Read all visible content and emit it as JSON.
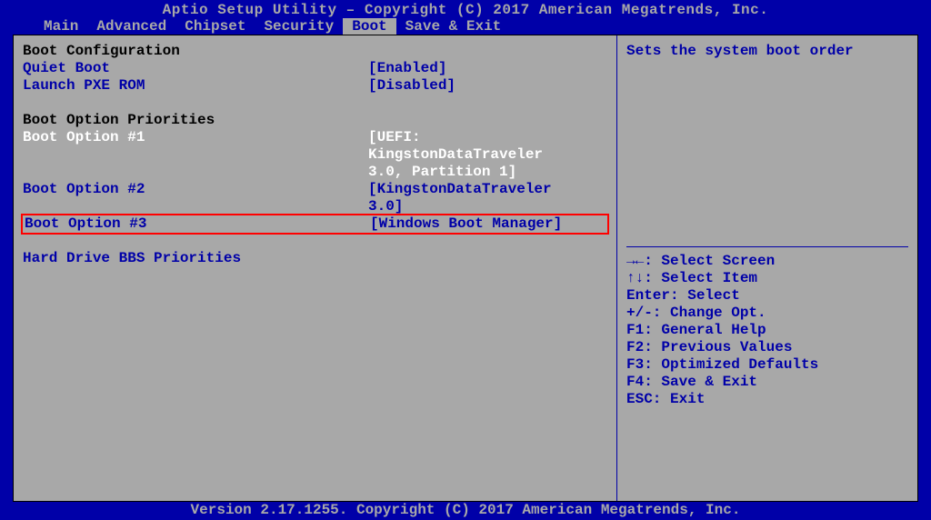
{
  "header": {
    "title": "Aptio Setup Utility – Copyright (C) 2017 American Megatrends, Inc.",
    "menu": [
      "Main",
      "Advanced",
      "Chipset",
      "Security",
      "Boot",
      "Save & Exit"
    ],
    "active_index": 4
  },
  "main": {
    "section1_title": "Boot Configuration",
    "quiet_boot_label": "Quiet Boot",
    "quiet_boot_value": "[Enabled]",
    "launch_pxe_label": "Launch PXE ROM",
    "launch_pxe_value": "[Disabled]",
    "section2_title": "Boot Option Priorities",
    "boot1_label": "Boot Option #1",
    "boot1_value": "[UEFI:\nKingstonDataTraveler\n3.0, Partition 1]",
    "boot2_label": "Boot Option #2",
    "boot2_value": "[KingstonDataTraveler\n3.0]",
    "boot3_label": "Boot Option #3",
    "boot3_value": "[Windows Boot Manager]",
    "hard_drive_label": "Hard Drive BBS Priorities"
  },
  "help": {
    "context": "Sets the system boot order",
    "keys": [
      "→←: Select Screen",
      "↑↓: Select Item",
      "Enter: Select",
      "+/-: Change Opt.",
      "F1: General Help",
      "F2: Previous Values",
      "F3: Optimized Defaults",
      "F4: Save & Exit",
      "ESC: Exit"
    ]
  },
  "footer": {
    "text": "Version 2.17.1255. Copyright (C) 2017 American Megatrends, Inc."
  }
}
